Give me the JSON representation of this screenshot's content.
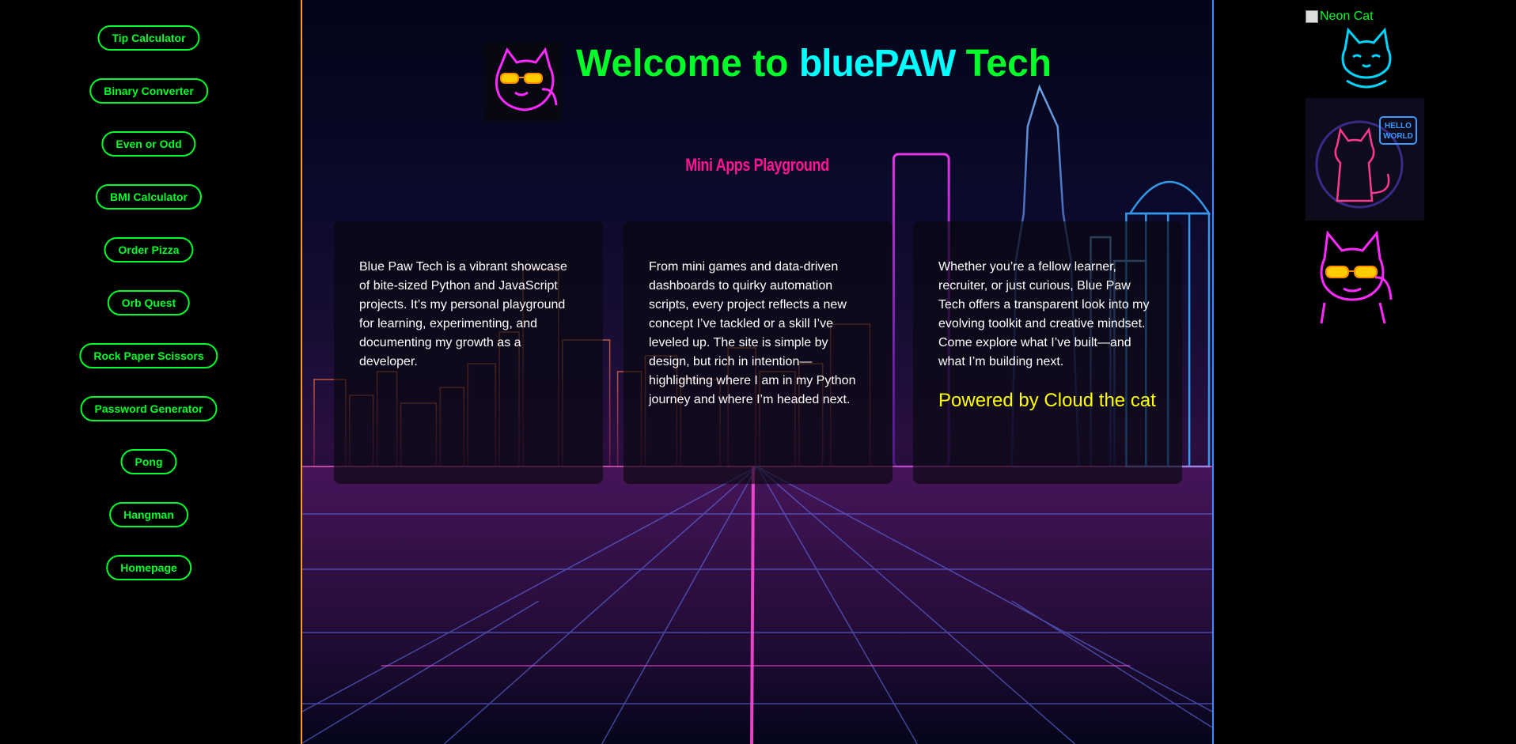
{
  "sidebar": {
    "items": [
      {
        "label": "Tip Calculator"
      },
      {
        "label": "Binary Converter"
      },
      {
        "label": "Even or Odd"
      },
      {
        "label": "BMI Calculator"
      },
      {
        "label": "Order Pizza"
      },
      {
        "label": "Orb Quest"
      },
      {
        "label": "Rock Paper Scissors"
      },
      {
        "label": "Password Generator"
      },
      {
        "label": "Pong"
      },
      {
        "label": "Hangman"
      },
      {
        "label": "Homepage"
      }
    ]
  },
  "header": {
    "title_prefix": "Welcome to ",
    "brand": "bluePAW",
    "title_suffix": " Tech",
    "subtitle": "Mini Apps Playground"
  },
  "cards": [
    {
      "text": "Blue Paw Tech is a vibrant showcase of bite-sized Python and JavaScript projects. It’s my personal playground for learning, experimenting, and documenting my growth as a developer."
    },
    {
      "text": "From mini games and data-driven dashboards to quirky automation scripts, every project reflects a new concept I’ve tackled or a skill I’ve leveled up. The site is simple by design, but rich in intention—highlighting where I am in my Python journey and where I’m headed next."
    },
    {
      "text": "Whether you’re a fellow learner, recruiter, or just curious, Blue Paw Tech offers a transparent look into my evolving toolkit and creative mindset. Come explore what I’ve built—and what I’m building next.",
      "powered": "Powered by Cloud the cat"
    }
  ],
  "right_column": {
    "broken_image_alt": "Neon Cat",
    "hello_world_sign": "HELLO WORLD"
  },
  "colors": {
    "nav_green": "#00ff2a",
    "brand_cyan": "#00ffff",
    "subtitle_pink": "#ff1493",
    "powered_yellow": "#ffff00"
  }
}
